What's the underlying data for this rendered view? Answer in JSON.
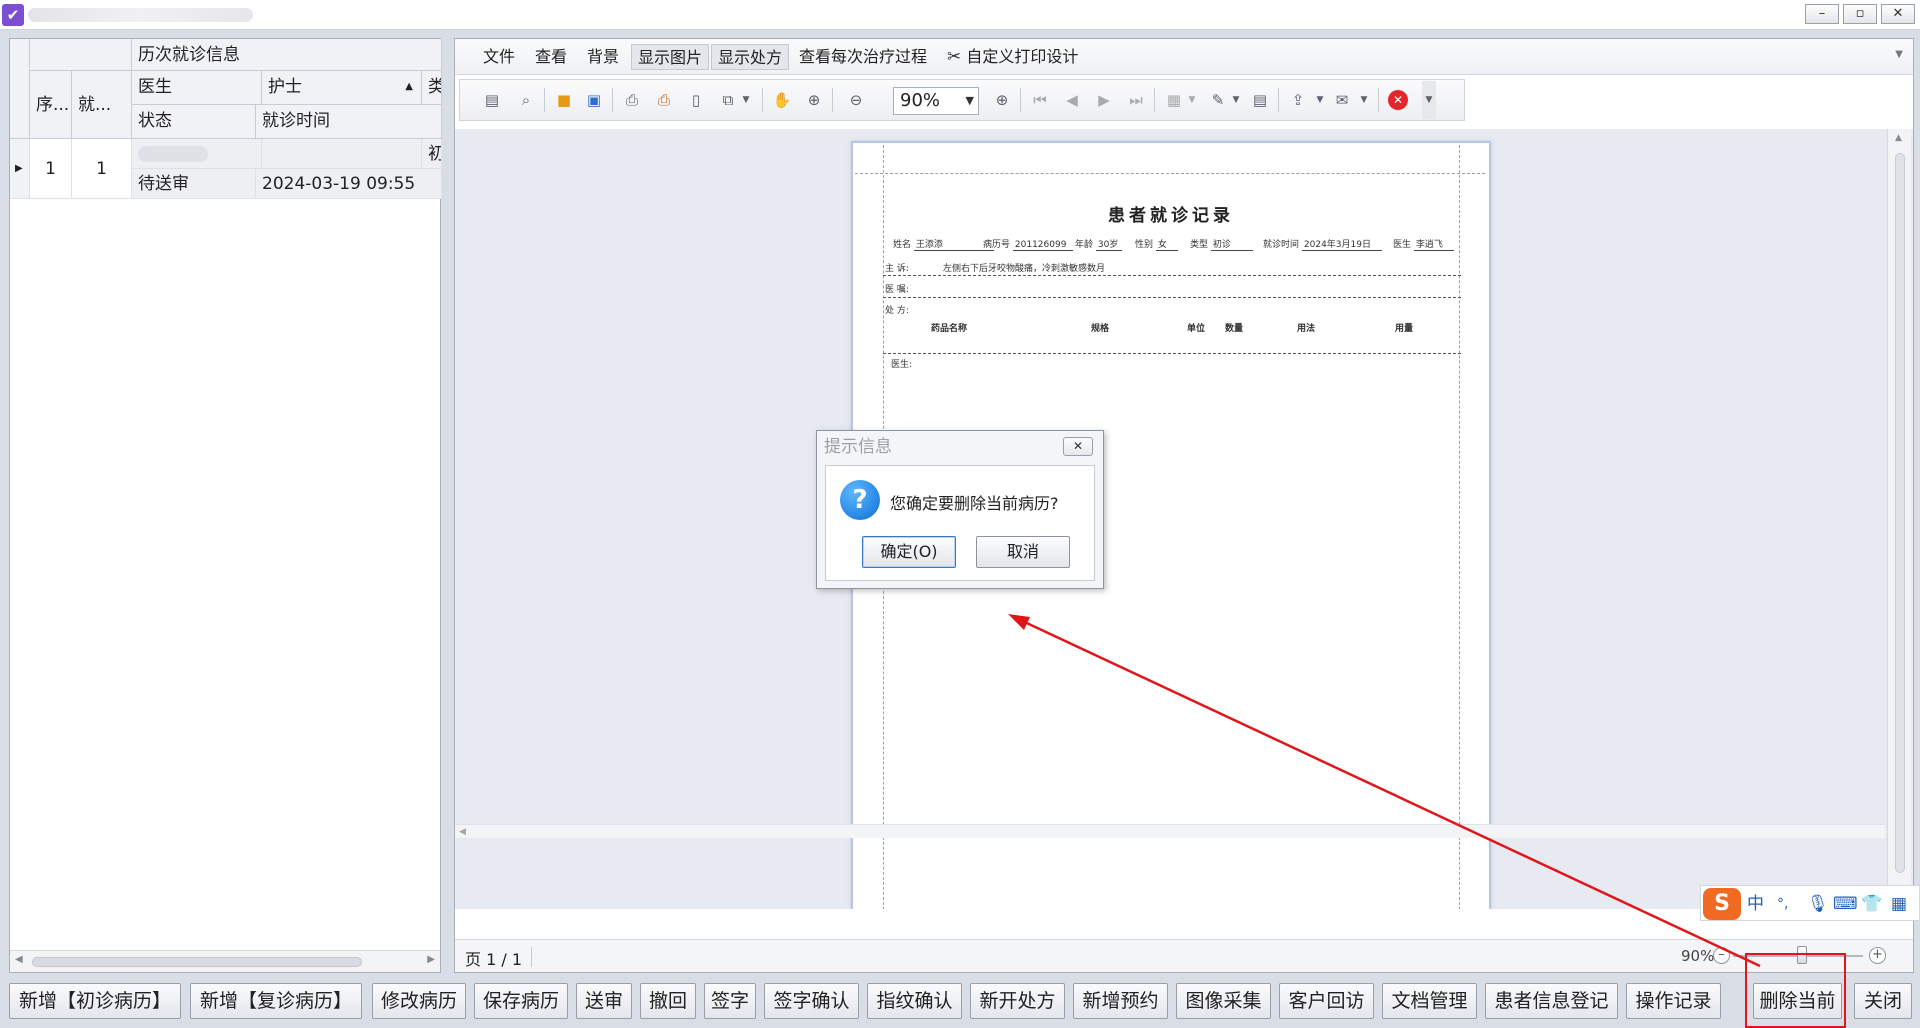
{
  "window": {
    "icon": "✔",
    "minimize": "–",
    "restore": "▫",
    "close": "✕"
  },
  "grid": {
    "band_title": "历次就诊信息",
    "headers": {
      "seq": "序...",
      "visit": "就...",
      "doctor": "医生",
      "nurse": "护士",
      "type": "类",
      "status": "状态",
      "visit_time": "就诊时间"
    },
    "rows": [
      {
        "seq": "1",
        "visit": "1",
        "type": "初诊",
        "status": "待送审",
        "visit_time": "2024-03-19 09:55"
      }
    ]
  },
  "menu": {
    "items": [
      "文件",
      "查看",
      "背景",
      "显示图片",
      "显示处方",
      "查看每次治疗过程",
      "自定义打印设计"
    ]
  },
  "toolbar": {
    "zoom_value": "90%"
  },
  "document": {
    "title": "患者就诊记录",
    "name_label": "姓名",
    "name_value": "王添添",
    "record_label": "病历号",
    "record_value": "201126099",
    "age_label": "年龄",
    "age_value": "30岁",
    "sex_label": "性别",
    "sex_value": "女",
    "type_label": "类型",
    "type_value": "初诊",
    "time_label": "就诊时间",
    "time_value": "2024年3月19日",
    "doctor_label": "医生",
    "doctor_value": "李逍飞",
    "complaint_label": "主  诉:",
    "complaint_value": "左侧右下后牙咬物酸痛，冷刺激敏感数月",
    "diagnosis_label": "医  嘱:",
    "rx_label": "处    方:",
    "rx_columns": [
      "药品名称",
      "规格",
      "单位",
      "数量",
      "用法",
      "用量"
    ],
    "doctor_sign": "医生:"
  },
  "status": {
    "page": "页 1 / 1",
    "zoom": "90%"
  },
  "dialog": {
    "title": "提示信息",
    "message": "您确定要删除当前病历?",
    "ok": "确定(O)",
    "cancel": "取消"
  },
  "ime": {
    "logo": "S",
    "mode": "中",
    "punct": "°,"
  },
  "bottom_buttons": [
    "新增【初诊病历】",
    "新增【复诊病历】",
    "修改病历",
    "保存病历",
    "送审",
    "撤回",
    "签字",
    "签字确认",
    "指纹确认",
    "新开处方",
    "新增预约",
    "图像采集",
    "客户回访",
    "文档管理",
    "患者信息登记",
    "操作记录",
    "删除当前",
    "关闭"
  ],
  "colors": {
    "annotation": "#e0161b",
    "accent": "#0a6fd6"
  }
}
